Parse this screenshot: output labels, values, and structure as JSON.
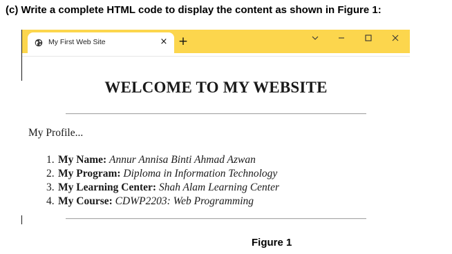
{
  "question": {
    "text": "(c) Write a complete HTML code to display the content as shown in Figure 1:"
  },
  "browser": {
    "tab_title": "My First Web Site",
    "tab_icon": "globe-icon",
    "close_tab_glyph": "×",
    "new_tab_glyph": "+",
    "window_controls": [
      "chevron-down-icon",
      "minimize-icon",
      "maximize-icon",
      "close-icon"
    ],
    "titlebar_color": "#fcd64d"
  },
  "page": {
    "heading": "WELCOME TO MY WEBSITE",
    "profile_label": "My Profile...",
    "profile_items": [
      {
        "num": "1.",
        "key": "My Name:",
        "value": "Annur Annisa Binti Ahmad Azwan"
      },
      {
        "num": "2.",
        "key": "My Program:",
        "value": "Diploma in Information Technology"
      },
      {
        "num": "3.",
        "key": "My Learning Center:",
        "value": "Shah Alam Learning Center"
      },
      {
        "num": "4.",
        "key": "My Course:",
        "value": "CDWP2203: Web Programming"
      }
    ]
  },
  "caption": "Figure 1"
}
